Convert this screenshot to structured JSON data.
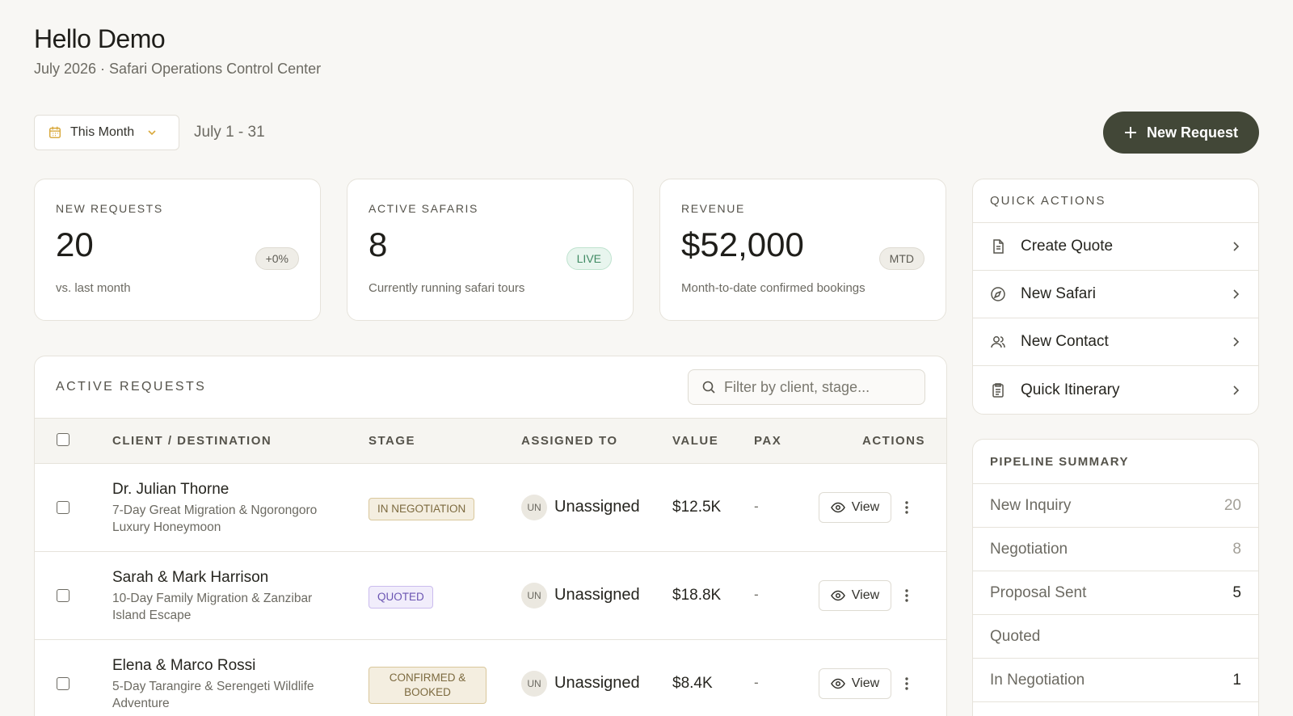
{
  "header": {
    "title": "Hello Demo",
    "subtitle": "July 2026 · Safari Operations Control Center"
  },
  "toolbar": {
    "period": "This Month",
    "date_range": "July 1 - 31",
    "new_request": "New Request"
  },
  "stats": [
    {
      "label": "NEW REQUESTS",
      "value": "20",
      "badge": "+0%",
      "sub": "vs. last month"
    },
    {
      "label": "ACTIVE SAFARIS",
      "value": "8",
      "badge": "LIVE",
      "sub": "Currently running safari tours"
    },
    {
      "label": "REVENUE",
      "value": "$52,000",
      "badge": "MTD",
      "sub": "Month-to-date confirmed bookings"
    }
  ],
  "quick_actions": {
    "title": "QUICK ACTIONS",
    "items": [
      {
        "label": "Create Quote",
        "icon": "document-icon"
      },
      {
        "label": "New Safari",
        "icon": "compass-icon"
      },
      {
        "label": "New Contact",
        "icon": "users-icon"
      },
      {
        "label": "Quick Itinerary",
        "icon": "clipboard-icon"
      }
    ]
  },
  "pipeline": {
    "title": "PIPELINE SUMMARY",
    "rows": [
      {
        "label": "New Inquiry",
        "count": "20"
      },
      {
        "label": "Negotiation",
        "count": "8"
      },
      {
        "label": "Proposal Sent",
        "count": "5"
      },
      {
        "label": "Quoted",
        "count": ""
      },
      {
        "label": "In Negotiation",
        "count": "1"
      }
    ]
  },
  "requests": {
    "title": "ACTIVE REQUESTS",
    "filter_placeholder": "Filter by client, stage...",
    "columns": {
      "client": "CLIENT / DESTINATION",
      "stage": "STAGE",
      "assigned": "ASSIGNED TO",
      "value": "VALUE",
      "pax": "PAX",
      "actions": "ACTIONS"
    },
    "view_label": "View",
    "rows": [
      {
        "client": "Dr. Julian Thorne",
        "destination": "7-Day Great Migration & Ngorongoro Luxury Honeymoon",
        "stage": "IN NEGOTIATION",
        "initials": "UN",
        "assignee": "Unassigned",
        "value": "$12.5K",
        "pax": "-"
      },
      {
        "client": "Sarah & Mark Harrison",
        "destination": "10-Day Family Migration & Zanzibar Island Escape",
        "stage": "QUOTED",
        "initials": "UN",
        "assignee": "Unassigned",
        "value": "$18.8K",
        "pax": "-"
      },
      {
        "client": "Elena & Marco Rossi",
        "destination": "5-Day Tarangire & Serengeti Wildlife Adventure",
        "stage": "CONFIRMED & BOOKED",
        "initials": "UN",
        "assignee": "Unassigned",
        "value": "$8.4K",
        "pax": "-"
      }
    ]
  },
  "colors": {
    "accent": "#424737",
    "background": "#f8f7f4",
    "live": "#3f8a63",
    "quoted": "#6b55b2"
  }
}
